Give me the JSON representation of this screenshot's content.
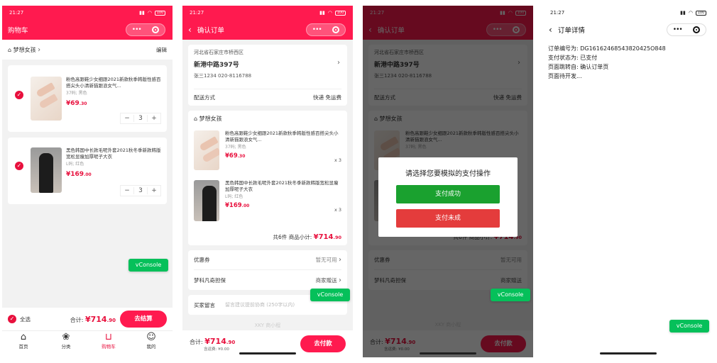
{
  "status_time": "21:27",
  "battery": "100",
  "cart": {
    "title": "购物车",
    "shop": "梦想女孩",
    "edit": "编辑",
    "items": [
      {
        "name": "粉色高跟鞋少女细跟2021新款秋季韩版性感百搭尖头小清新猫跟浪女气...",
        "spec": "37码; 黑色",
        "price_int": "¥69",
        "price_dec": ".30",
        "qty": "3",
        "thumb": "shoe"
      },
      {
        "name": "黑色韩国中长款毛呢外套2021秋冬季新款韩版宽松显瘦加厚呢子大衣",
        "spec": "L码; 红色",
        "price_int": "¥169",
        "price_dec": ".00",
        "qty": "3",
        "thumb": "coat"
      }
    ],
    "select_all": "全选",
    "total_label": "合计:",
    "total_int": "¥714",
    "total_dec": ".90",
    "checkout": "去结算",
    "tabs": [
      {
        "label": "首页",
        "icon": "home-icon"
      },
      {
        "label": "分类",
        "icon": "category-icon"
      },
      {
        "label": "购物车",
        "icon": "cart-icon"
      },
      {
        "label": "我的",
        "icon": "user-icon"
      }
    ]
  },
  "confirm": {
    "title": "确认订单",
    "address_region": "河北省石家庄市桥西区",
    "address_street": "新港中路397号",
    "contact": "张三1234 020-8116788",
    "delivery_label": "配送方式",
    "delivery_value": "快递 免运费",
    "shop": "梦想女孩",
    "items": [
      {
        "name": "粉色高跟鞋少女细跟2021新款秋季韩版性感百搭尖头小清新猫跟浪女气...",
        "spec": "37码; 黑色",
        "price_int": "¥69",
        "price_dec": ".30",
        "qty": "x 3",
        "thumb": "shoe"
      },
      {
        "name": "黑色韩国中长款毛呢外套2021秋冬季新款韩版宽松显瘦加厚呢子大衣",
        "spec": "L码; 红色",
        "price_int": "¥169",
        "price_dec": ".00",
        "qty": "x 3",
        "thumb": "coat"
      }
    ],
    "count": "共6件",
    "subtotal_label": "商品小计:",
    "subtotal_int": "¥714",
    "subtotal_dec": ".90",
    "coupon_label": "优惠券",
    "coupon_value": "暂无可用",
    "insurance_label": "梦科凡奇担保",
    "insurance_value": "商家赠送",
    "message_label": "买家留言",
    "message_placeholder": "留言建议提前协商 (250字以内)",
    "watermark": "XKY 商小程",
    "total_label": "合计:",
    "total_int": "¥714",
    "total_dec": ".90",
    "shipping": "含运费: ¥0.00",
    "pay": "去付款"
  },
  "dialog": {
    "title": "请选择您要模拟的支付操作",
    "success": "支付成功",
    "fail": "支付未成"
  },
  "detail": {
    "title": "订单详情",
    "lines": [
      "订单编号为: DG16162468543820425O848",
      "支付状态为: 已支付",
      "页面跳转自: 确认订单页",
      "页面待开发..."
    ]
  },
  "vconsole": "vConsole",
  "colors": {
    "brand": "#ff1a4f",
    "price": "#e8103d",
    "vconsole": "#05c05a",
    "pay_success": "#1aa12f",
    "pay_fail": "#e43c3c"
  }
}
